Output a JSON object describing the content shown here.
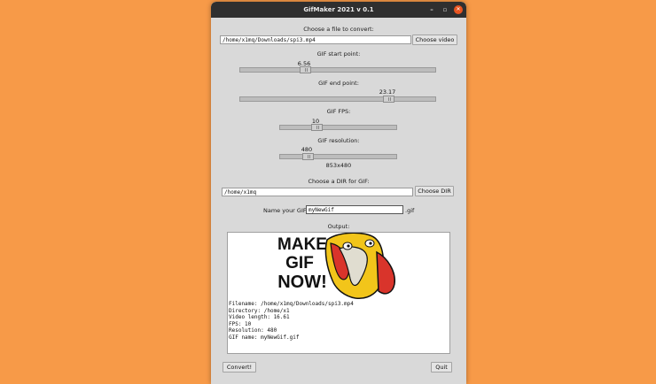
{
  "window": {
    "title": "GifMaker 2021 v 0.1"
  },
  "titlebar_icons": [
    "minimize-icon",
    "maximize-icon",
    "close-icon"
  ],
  "file": {
    "label": "Choose a file to convert:",
    "path": "/home/x1mq/Downloads/spi3.mp4",
    "button": "Choose video"
  },
  "start": {
    "label": "GIF start point:",
    "value": "6.56",
    "fraction": 0.32
  },
  "end": {
    "label": "GIF end point:",
    "value": "23.17",
    "fraction": 0.77
  },
  "fps": {
    "label": "GIF FPS:",
    "value": "10",
    "fraction": 0.29
  },
  "resolution": {
    "label": "GIF resolution:",
    "value": "480",
    "fraction": 0.21,
    "dimensions": "853x480"
  },
  "dir": {
    "label": "Choose a DIR for GIF:",
    "path": "/home/x1mq",
    "button": "Choose DIR"
  },
  "name": {
    "label": "Name your GIF:",
    "value": "myNewGif",
    "suffix": ".gif"
  },
  "output": {
    "label": "Output:",
    "image_text": [
      "MAKE",
      "GIF",
      "NOW!"
    ],
    "lines": [
      "Filename: /home/x1mq/Downloads/spi3.mp4",
      "Directory: /home/x1",
      "Video length: 16.61",
      "FPS: 10",
      "Resolution: 480",
      "GIF name: myNewGif.gif"
    ]
  },
  "actions": {
    "convert": "Convert!",
    "quit": "Quit"
  },
  "colors": {
    "desktop": "#f79a48",
    "titlebar": "#2f2f2f",
    "close": "#e95420",
    "bird": "#f2c51a",
    "beak": "#d9342b"
  }
}
